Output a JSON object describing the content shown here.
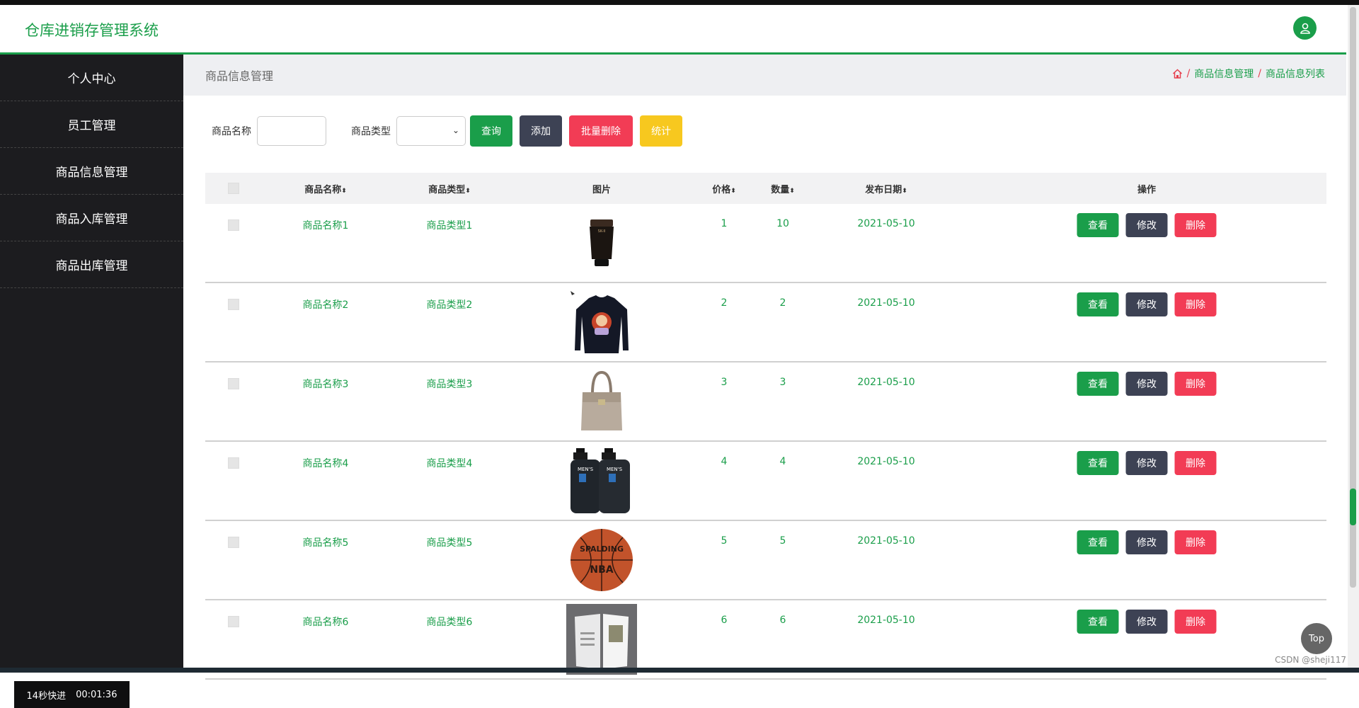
{
  "app": {
    "title": "仓库进销存管理系统"
  },
  "sidebar": {
    "items": [
      {
        "label": "个人中心"
      },
      {
        "label": "员工管理"
      },
      {
        "label": "商品信息管理"
      },
      {
        "label": "商品入库管理"
      },
      {
        "label": "商品出库管理"
      }
    ]
  },
  "timer": {
    "speed": "14秒快进",
    "time": "00:01:36"
  },
  "page": {
    "title": "商品信息管理",
    "breadcrumb": [
      "商品信息管理",
      "商品信息列表"
    ]
  },
  "search": {
    "name_label": "商品名称",
    "type_label": "商品类型",
    "query": "查询",
    "add": "添加",
    "batch_delete": "批量删除",
    "stats": "统计"
  },
  "table": {
    "headers": {
      "name": "商品名称",
      "type": "商品类型",
      "image": "图片",
      "price": "价格",
      "qty": "数量",
      "date": "发布日期",
      "ops": "操作"
    },
    "rows": [
      {
        "name": "商品名称1",
        "type": "商品类型1",
        "price": "1",
        "qty": "10",
        "date": "2021-05-10",
        "image": "tube"
      },
      {
        "name": "商品名称2",
        "type": "商品类型2",
        "price": "2",
        "qty": "2",
        "date": "2021-05-10",
        "image": "sweater"
      },
      {
        "name": "商品名称3",
        "type": "商品类型3",
        "price": "3",
        "qty": "3",
        "date": "2021-05-10",
        "image": "handbag"
      },
      {
        "name": "商品名称4",
        "type": "商品类型4",
        "price": "4",
        "qty": "4",
        "date": "2021-05-10",
        "image": "bottles"
      },
      {
        "name": "商品名称5",
        "type": "商品类型5",
        "price": "5",
        "qty": "5",
        "date": "2021-05-10",
        "image": "basketball"
      },
      {
        "name": "商品名称6",
        "type": "商品类型6",
        "price": "6",
        "qty": "6",
        "date": "2021-05-10",
        "image": "magazine"
      }
    ],
    "actions": {
      "view": "查看",
      "edit": "修改",
      "delete": "删除"
    }
  },
  "top_button": "Top",
  "watermark": "CSDN @sheji117",
  "colors": {
    "accent": "#1a9e4a",
    "dark_btn": "#3d4254",
    "danger": "#f23c55",
    "stats": "#f7c81f"
  }
}
